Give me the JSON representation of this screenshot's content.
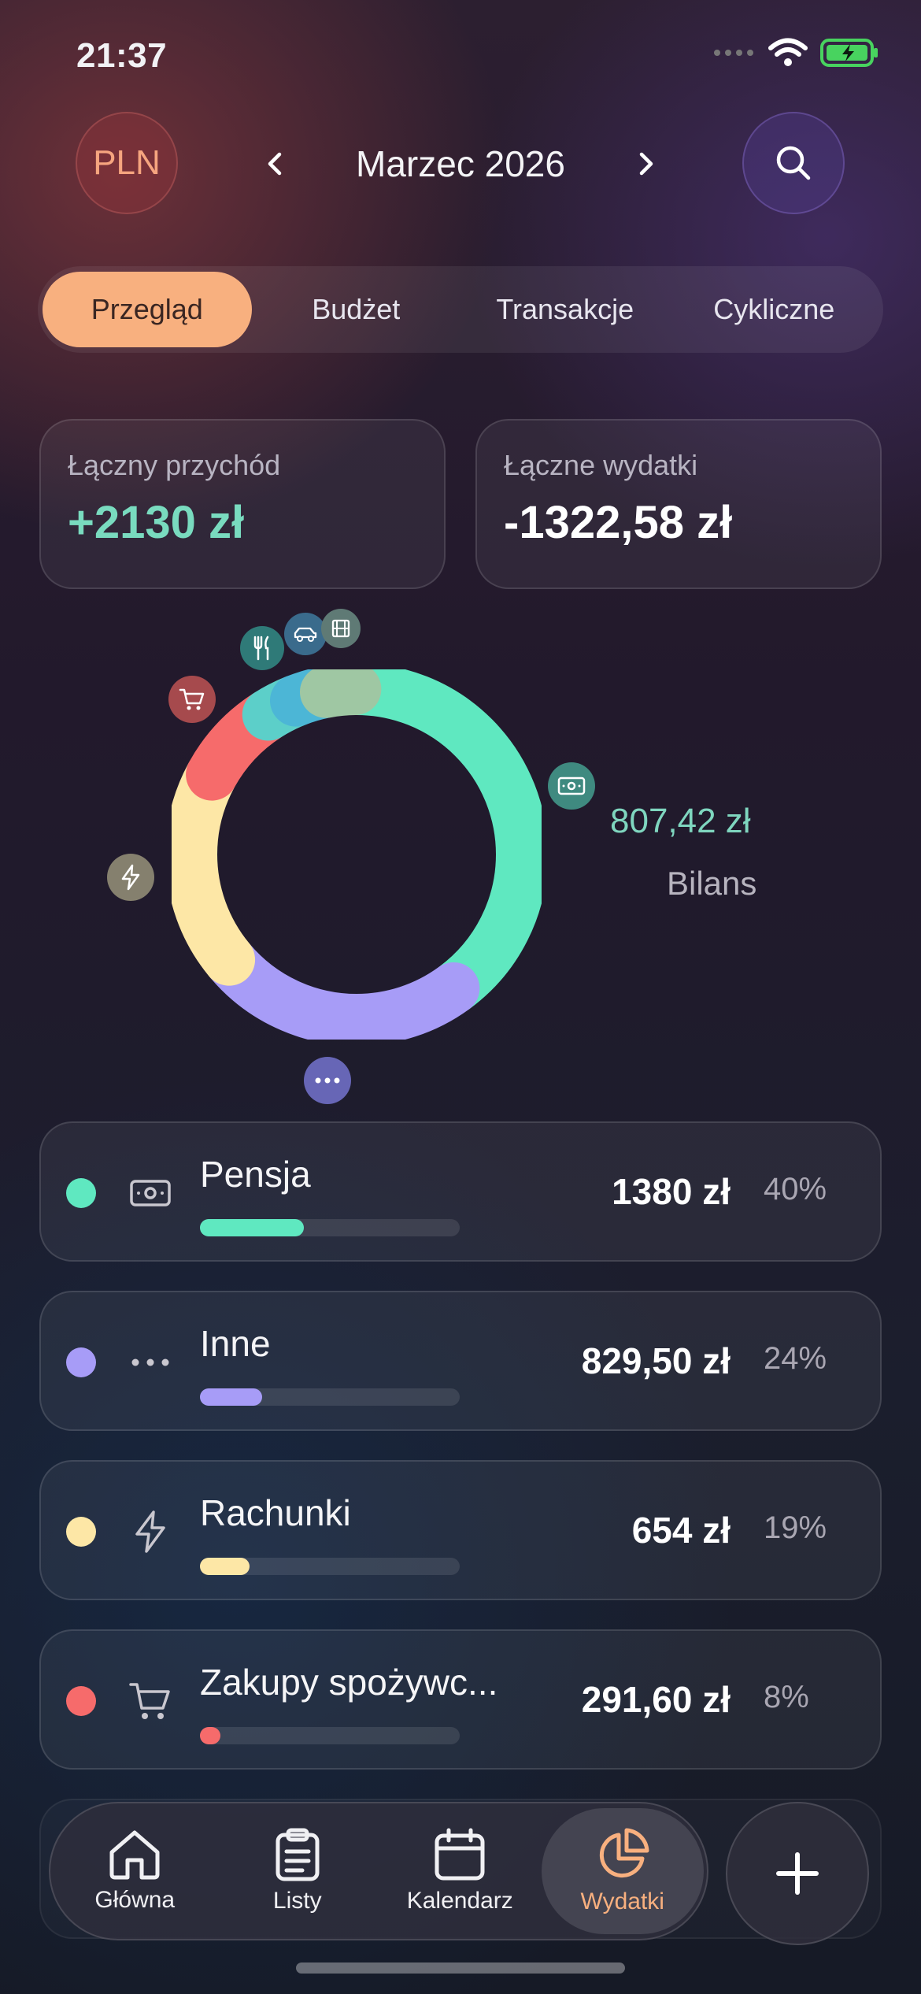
{
  "status_bar": {
    "time": "21:37"
  },
  "header": {
    "currency": "PLN",
    "month": "Marzec 2026"
  },
  "tabs": [
    {
      "label": "Przegląd",
      "active": true
    },
    {
      "label": "Budżet",
      "active": false
    },
    {
      "label": "Transakcje",
      "active": false
    },
    {
      "label": "Cykliczne",
      "active": false
    }
  ],
  "summary": {
    "income_label": "Łączny przychód",
    "income_value": "+2130 zł",
    "expenses_label": "Łączne wydatki",
    "expenses_value": "-1322,58 zł"
  },
  "donut": {
    "balance_value": "807,42 zł",
    "balance_label": "Bilans",
    "segment_icons": [
      "banknote-icon",
      "ellipsis-icon",
      "bolt-icon",
      "cart-icon",
      "fork-knife-icon",
      "car-icon",
      "film-icon"
    ]
  },
  "chart_data": {
    "type": "pie",
    "categories": [
      "Pensja",
      "Inne",
      "Rachunki",
      "Zakupy spożywcze",
      "Jedzenie",
      "Transport",
      "Rozrywka"
    ],
    "percent": [
      40,
      24,
      19,
      8,
      3,
      3,
      3
    ]
  },
  "categories": [
    {
      "name": "Pensja",
      "amount": "1380 zł",
      "percent": "40%",
      "fraction": 0.4,
      "color": "#5fe8c0",
      "icon": "banknote-icon"
    },
    {
      "name": "Inne",
      "amount": "829,50 zł",
      "percent": "24%",
      "fraction": 0.24,
      "color": "#a79cf7",
      "icon": "ellipsis-icon"
    },
    {
      "name": "Rachunki",
      "amount": "654 zł",
      "percent": "19%",
      "fraction": 0.19,
      "color": "#fde7a6",
      "icon": "bolt-icon"
    },
    {
      "name": "Zakupy spożywc...",
      "amount": "291,60 zł",
      "percent": "8%",
      "fraction": 0.08,
      "color": "#f66b6b",
      "icon": "cart-icon"
    }
  ],
  "nav": [
    {
      "label": "Główna",
      "icon": "home-icon",
      "active": false
    },
    {
      "label": "Listy",
      "icon": "clipboard-icon",
      "active": false
    },
    {
      "label": "Kalendarz",
      "icon": "calendar-icon",
      "active": false
    },
    {
      "label": "Wydatki",
      "icon": "pie-chart-icon",
      "active": true
    }
  ]
}
